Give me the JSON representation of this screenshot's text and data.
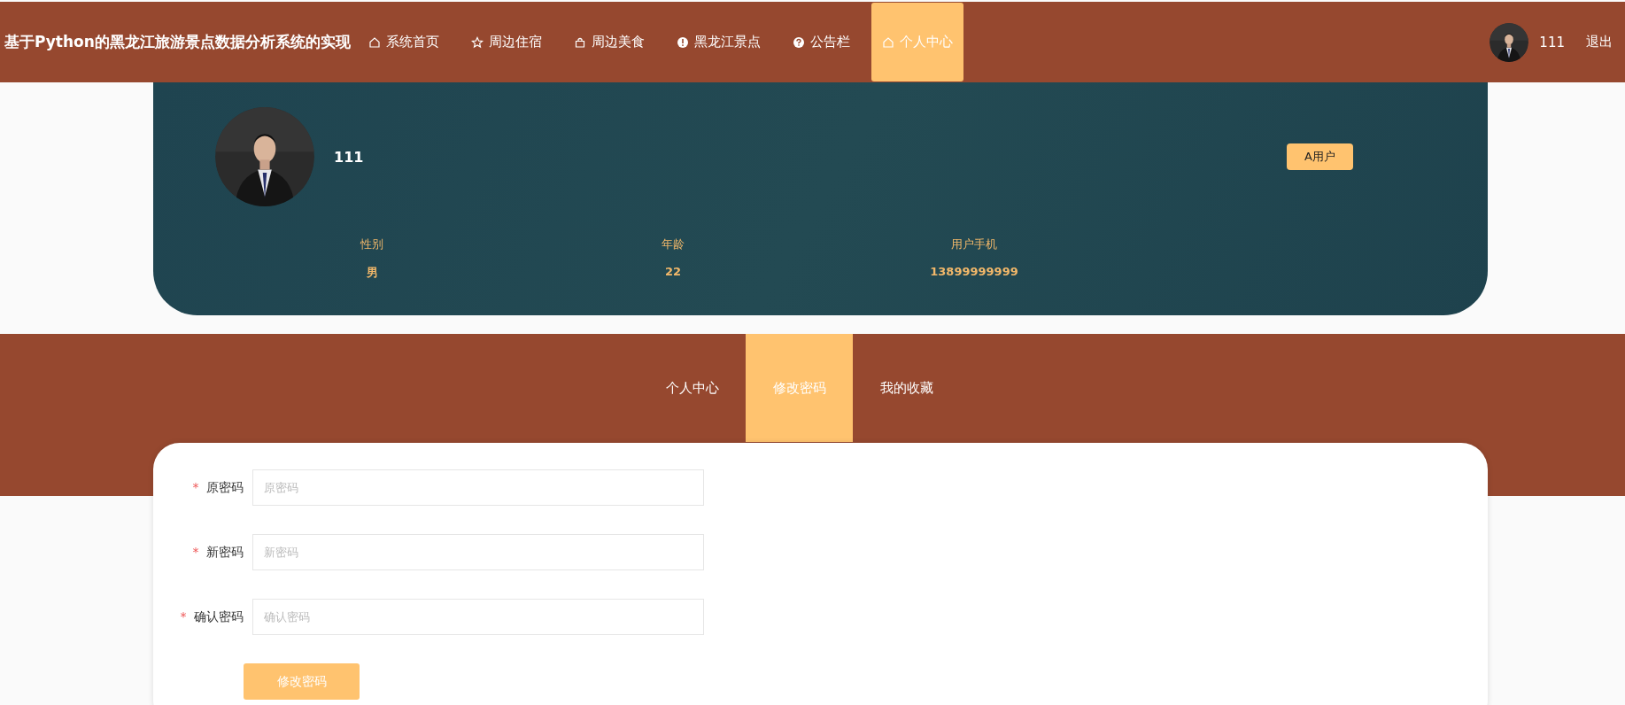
{
  "site_title": "基于Python的黑龙江旅游景点数据分析系统的实现",
  "nav": [
    {
      "label": "系统首页",
      "selected": false
    },
    {
      "label": "周边住宿",
      "selected": false
    },
    {
      "label": "周边美食",
      "selected": false
    },
    {
      "label": "黑龙江景点",
      "selected": false
    },
    {
      "label": "公告栏",
      "selected": false
    },
    {
      "label": "个人中心",
      "selected": true
    }
  ],
  "user": {
    "name": "111",
    "logout": "退出"
  },
  "profile": {
    "name": "111",
    "role": "A用户",
    "fields": [
      {
        "label": "性别",
        "value": "男"
      },
      {
        "label": "年龄",
        "value": "22"
      },
      {
        "label": "用户手机",
        "value": "13899999999"
      }
    ]
  },
  "tabs": [
    {
      "label": "个人中心",
      "selected": false
    },
    {
      "label": "修改密码",
      "selected": true
    },
    {
      "label": "我的收藏",
      "selected": false
    }
  ],
  "form": {
    "fields": [
      {
        "label": "原密码",
        "placeholder": "原密码",
        "required": true
      },
      {
        "label": "新密码",
        "placeholder": "新密码",
        "required": true
      },
      {
        "label": "确认密码",
        "placeholder": "确认密码",
        "required": true
      }
    ],
    "required_mark": "*",
    "submit": "修改密码"
  }
}
